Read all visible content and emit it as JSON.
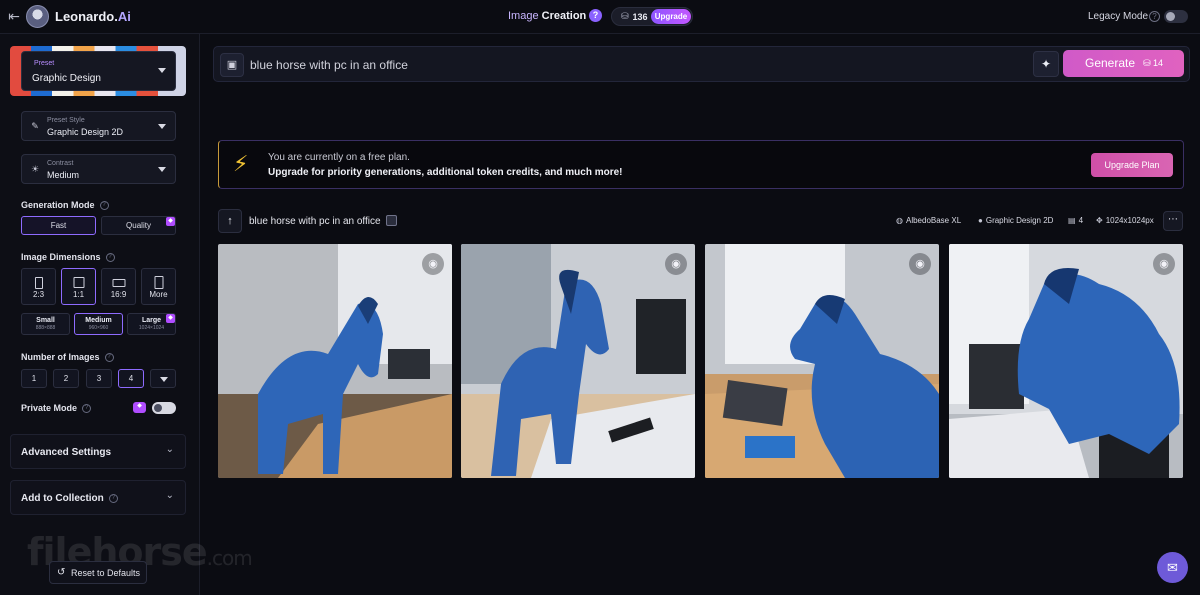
{
  "header": {
    "brand_name": "Leonardo.",
    "brand_suffix": "Ai",
    "mode_prefix": "Image",
    "mode_title": "Creation",
    "help_symbol": "?",
    "token_count": "136",
    "upgrade_label": "Upgrade",
    "legacy_mode_label": "Legacy Mode",
    "legacy_mode_on": false
  },
  "sidebar": {
    "preset": {
      "label": "Preset",
      "value": "Graphic Design"
    },
    "preset_style": {
      "label": "Preset Style",
      "value": "Graphic Design 2D"
    },
    "contrast": {
      "label": "Contrast",
      "value": "Medium"
    },
    "generation_mode": {
      "label": "Generation Mode",
      "options": [
        "Fast",
        "Quality"
      ],
      "selected": "Fast"
    },
    "image_dimensions": {
      "label": "Image Dimensions",
      "ratios": [
        "2:3",
        "1:1",
        "16:9",
        "More"
      ],
      "selected_ratio": "1:1",
      "sizes": [
        {
          "name": "Small",
          "res": "888×888"
        },
        {
          "name": "Medium",
          "res": "960×960"
        },
        {
          "name": "Large",
          "res": "1024×1024"
        }
      ],
      "selected_size": "Medium"
    },
    "number_of_images": {
      "label": "Number of Images",
      "options": [
        "1",
        "2",
        "3",
        "4"
      ],
      "selected": "4"
    },
    "private_mode": {
      "label": "Private Mode",
      "on": false
    },
    "advanced_settings_label": "Advanced Settings",
    "add_to_collection_label": "Add to Collection",
    "reset_label": "Reset to Defaults",
    "watermark": {
      "text": "filehorse",
      "suffix": ".com"
    }
  },
  "prompt": {
    "value": "blue horse with pc in an office",
    "generate_label": "Generate",
    "generate_cost": "14"
  },
  "promo": {
    "line1": "You are currently on a free plan.",
    "line2": "Upgrade for priority generations, additional token credits, and much more!",
    "button_label": "Upgrade Plan"
  },
  "generation": {
    "prompt": "blue horse with pc in an office",
    "model": "AlbedoBase XL",
    "style": "Graphic Design 2D",
    "image_count": "4",
    "resolution": "1024x1024px",
    "images": [
      {
        "alt": "blue horse in office 1"
      },
      {
        "alt": "blue horse in office 2"
      },
      {
        "alt": "blue horse in office 3"
      },
      {
        "alt": "blue horse in office 4"
      }
    ]
  },
  "colors": {
    "accent": "#8e6bff",
    "generate": "#d05ac8",
    "background": "#0b0c12",
    "horse_blue": "#2e66b8"
  }
}
